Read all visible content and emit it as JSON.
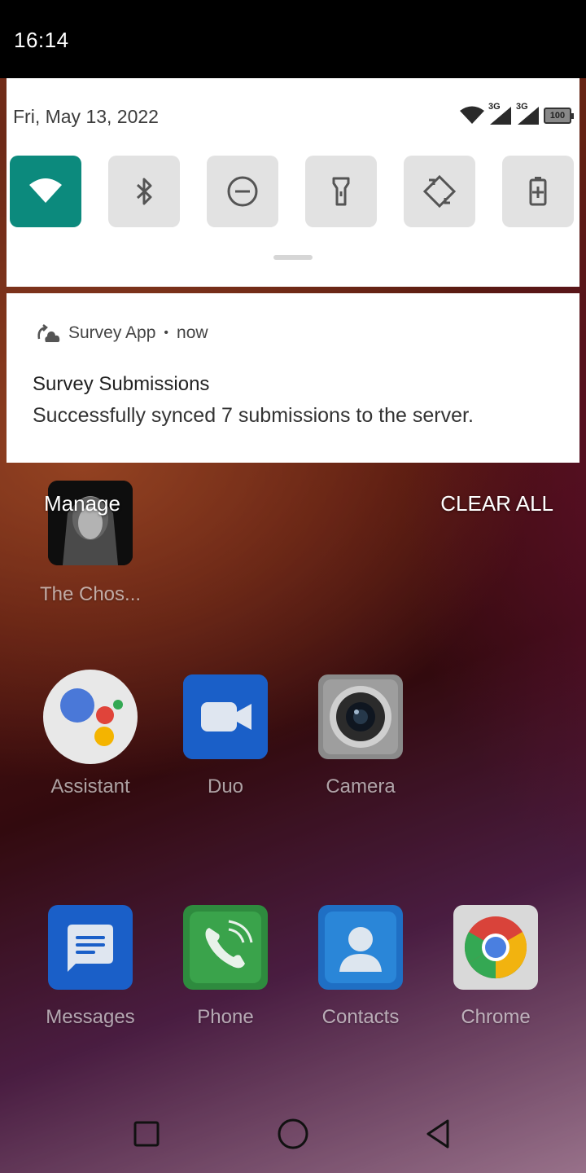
{
  "status_bar": {
    "time": "16:14",
    "network_label_1": "3G",
    "network_label_2": "3G",
    "battery_level": "100"
  },
  "quick_settings": {
    "date": "Fri, May 13, 2022",
    "tiles": [
      {
        "name": "wifi",
        "icon": "wifi-icon",
        "active": true
      },
      {
        "name": "bluetooth",
        "icon": "bluetooth-icon",
        "active": false
      },
      {
        "name": "do-not-disturb",
        "icon": "dnd-icon",
        "active": false
      },
      {
        "name": "flashlight",
        "icon": "flashlight-icon",
        "active": false
      },
      {
        "name": "auto-rotate",
        "icon": "rotate-icon",
        "active": false
      },
      {
        "name": "battery-saver",
        "icon": "battery-saver-icon",
        "active": false
      }
    ],
    "active_color": "#0c8a7d"
  },
  "notification": {
    "app_name": "Survey App",
    "separator": "•",
    "time": "now",
    "title": "Survey Submissions",
    "text": "Successfully synced 7 submissions to the server."
  },
  "actions": {
    "manage": "Manage",
    "clear_all": "CLEAR ALL"
  },
  "home": {
    "partial_app": "The Chos...",
    "row1": [
      "Assistant",
      "Duo",
      "Camera"
    ],
    "row2": [
      "Messages",
      "Phone",
      "Contacts",
      "Chrome"
    ]
  }
}
